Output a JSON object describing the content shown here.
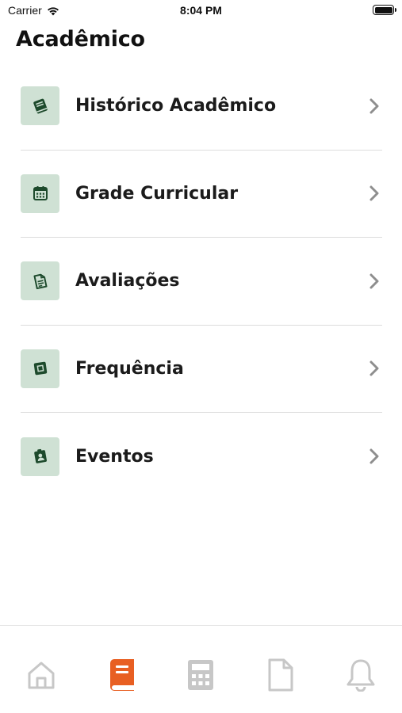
{
  "status_bar": {
    "carrier": "Carrier",
    "time": "8:04 PM"
  },
  "page": {
    "title": "Acadêmico"
  },
  "menu": {
    "items": [
      {
        "label": "Histórico Acadêmico",
        "icon": "book-icon"
      },
      {
        "label": "Grade Curricular",
        "icon": "calendar-icon"
      },
      {
        "label": "Avaliações",
        "icon": "document-icon"
      },
      {
        "label": "Frequência",
        "icon": "square-icon"
      },
      {
        "label": "Eventos",
        "icon": "badge-icon"
      }
    ]
  },
  "tab_bar": {
    "tabs": [
      {
        "icon": "home-icon",
        "active": false
      },
      {
        "icon": "book-icon",
        "active": true
      },
      {
        "icon": "calculator-icon",
        "active": false
      },
      {
        "icon": "file-icon",
        "active": false
      },
      {
        "icon": "bell-icon",
        "active": false
      }
    ]
  },
  "colors": {
    "icon_tile_bg": "#cfe1d4",
    "icon_green": "#1d4a2c",
    "active_tab": "#e85f22",
    "inactive_tab": "#c7c7c7",
    "chevron": "#8e8e8e"
  }
}
